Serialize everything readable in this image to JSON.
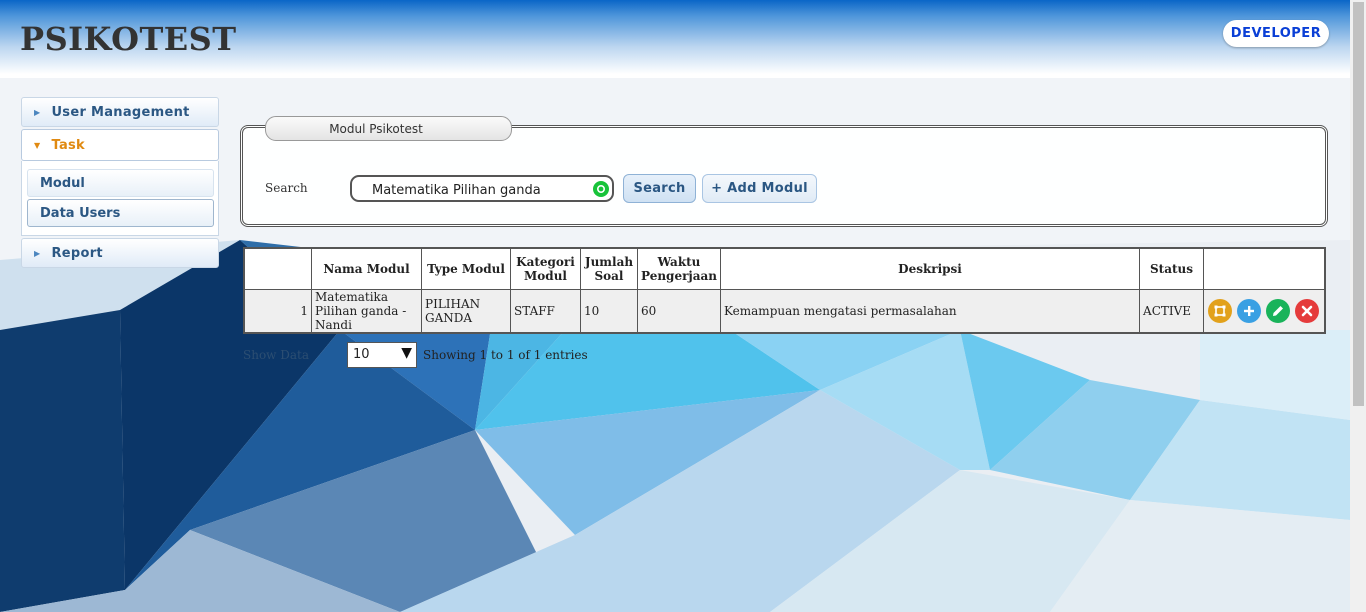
{
  "app": {
    "title": "PSIKOTEST",
    "role_button": "DEVELOPER"
  },
  "sidebar": {
    "sections": [
      {
        "label": "User Management",
        "expanded": false
      },
      {
        "label": "Task",
        "expanded": true,
        "items": [
          {
            "label": "Modul"
          },
          {
            "label": "Data Users"
          }
        ]
      },
      {
        "label": "Report",
        "expanded": false
      }
    ]
  },
  "panel": {
    "legend": "Modul Psikotest",
    "search_label": "Search",
    "search_value": "Matematika Pilihan ganda",
    "search_button": "Search",
    "add_button": "+ Add Modul"
  },
  "table": {
    "columns": [
      "",
      "Nama Modul",
      "Type Modul",
      "Kategori Modul",
      "Jumlah Soal",
      "Waktu Pengerjaan",
      "Deskripsi",
      "Status",
      ""
    ],
    "rows": [
      {
        "no": "1",
        "nama_modul": "Matematika Pilihan ganda -Nandi",
        "type_modul": "PILIHAN GANDA",
        "kategori_modul": "STAFF",
        "jumlah_soal": "10",
        "waktu_pengerjaan": "60",
        "deskripsi": "Kemampuan mengatasi permasalahan",
        "status": "ACTIVE",
        "actions": [
          "preview-icon",
          "add-icon",
          "edit-icon",
          "delete-icon"
        ]
      }
    ]
  },
  "pagination": {
    "show_label": "Show Data",
    "page_size": "10",
    "info": "Showing 1 to 1 of 1 entries"
  },
  "colors": {
    "accent_orange": "#e08a12",
    "role_text": "#0a3fd6",
    "header_blue": "#0a66c7"
  }
}
